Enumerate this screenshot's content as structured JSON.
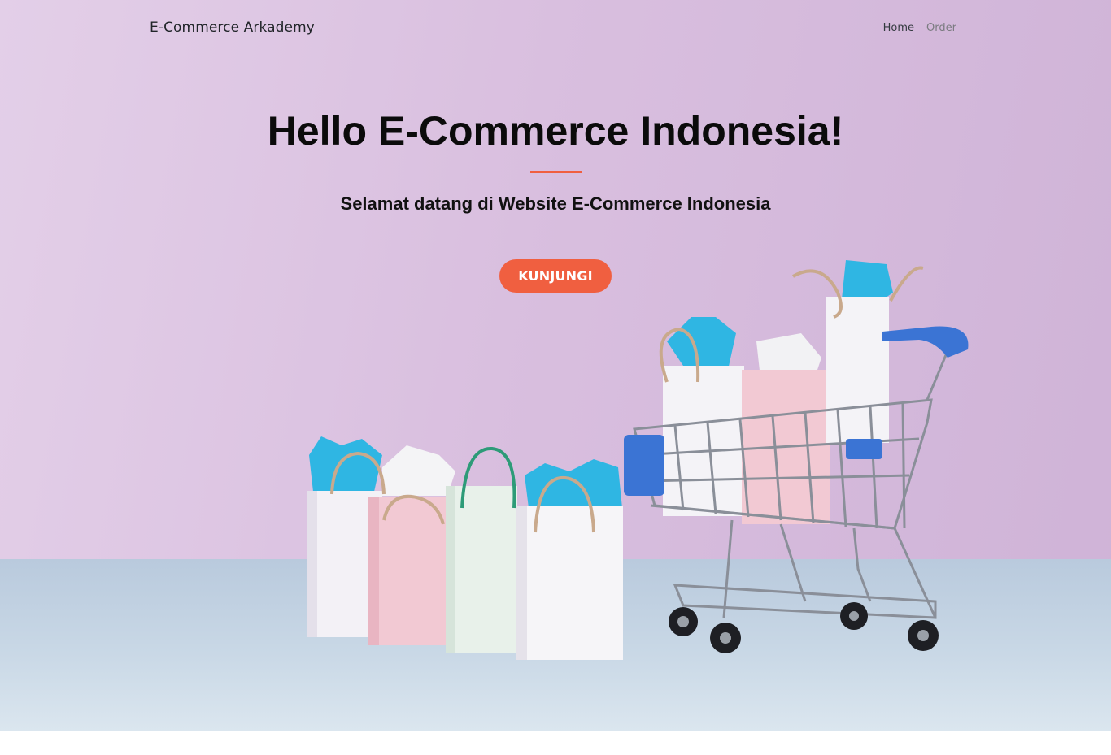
{
  "navbar": {
    "brand": "E-Commerce Arkademy",
    "links": [
      {
        "label": "Home"
      },
      {
        "label": "Order"
      }
    ]
  },
  "hero": {
    "title": "Hello E-Commerce Indonesia!",
    "subtitle": "Selamat datang di Website E-Commerce Indonesia",
    "cta_label": "KUNJUNGI",
    "accent_color": "#f05f40",
    "background_color": "#d9bfdf"
  },
  "image": {
    "subject": "shopping bags beside a shopping cart",
    "icon": "shopping-cart-icon"
  }
}
